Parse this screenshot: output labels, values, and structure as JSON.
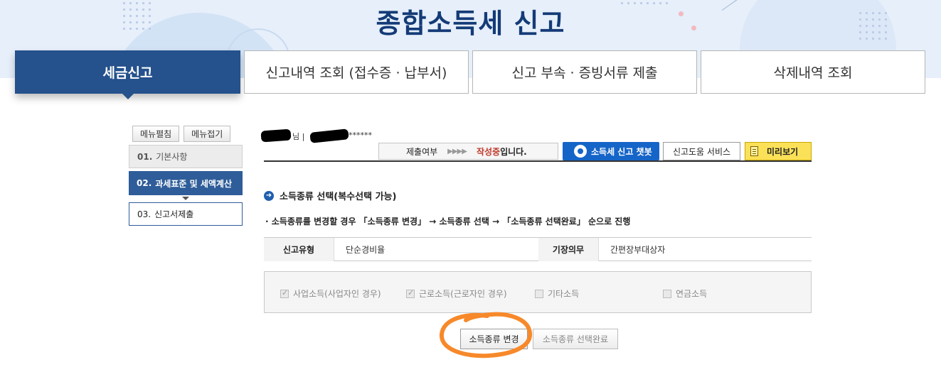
{
  "header": {
    "title": "종합소득세 신고"
  },
  "tabs": [
    {
      "label": "세금신고",
      "active": true
    },
    {
      "label": "신고내역 조회 (접수증 · 납부서)",
      "active": false
    },
    {
      "label": "신고 부속 · 증빙서류 제출",
      "active": false
    },
    {
      "label": "삭제내역 조회",
      "active": false
    }
  ],
  "sidebar": {
    "expand_label": "메뉴펼침",
    "collapse_label": "메뉴접기",
    "steps": [
      {
        "num": "01.",
        "label": "기본사항",
        "state": "done"
      },
      {
        "num": "02.",
        "label": "과세표준 및 세액계산",
        "state": "current"
      },
      {
        "num": "03.",
        "label": "신고서제출",
        "state": "pending"
      }
    ]
  },
  "user": {
    "name_suffix": "님 |",
    "id_mask": "******"
  },
  "status": {
    "label": "제출여부",
    "arrows": "▶▶▶▶",
    "state": "작성중",
    "state_suffix": "입니다."
  },
  "actions": {
    "chatbot_label": "소득세 신고 챗봇",
    "help_label": "신고도움 서비스",
    "preview_label": "미리보기"
  },
  "section": {
    "title": "소득종류 선택(복수선택 가능)",
    "notice": "· 소득종류를 변경할 경우 「소득종류 변경」 → 소득종류 선택 → 「소득종류 선택완료」 순으로 진행"
  },
  "info": {
    "report_type_label": "신고유형",
    "report_type_value": "단순경비율",
    "bookkeeping_label": "기장의무",
    "bookkeeping_value": "간편장부대상자"
  },
  "income_types": [
    {
      "label": "사업소득(사업자인 경우)",
      "checked": true
    },
    {
      "label": "근로소득(근로자인 경우)",
      "checked": true
    },
    {
      "label": "기타소득",
      "checked": false
    },
    {
      "label": "연금소득",
      "checked": false
    }
  ],
  "buttons": {
    "change_label": "소득종류 변경",
    "done_label": "소득종류 선택완료"
  },
  "colors": {
    "primary": "#25518c",
    "title": "#143b77",
    "chatbot": "#1565c8",
    "preview": "#fbe158",
    "status_state": "#c0392b",
    "highlight": "#f7892a"
  }
}
